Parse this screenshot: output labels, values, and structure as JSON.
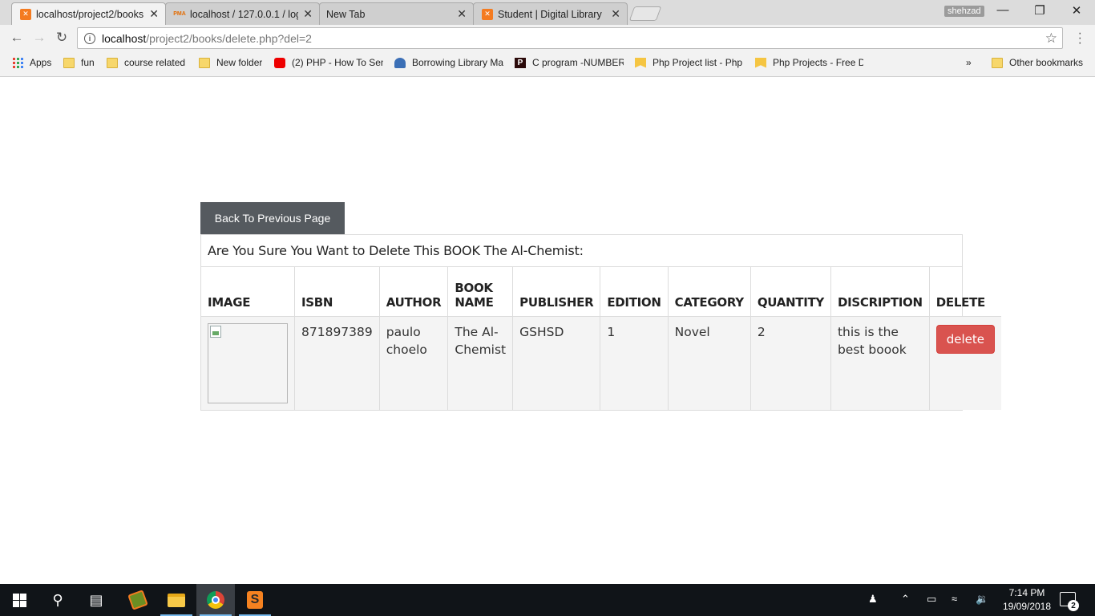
{
  "browser": {
    "tabs": [
      {
        "title": "localhost/project2/books",
        "favicon": "xampp-icon",
        "active": true
      },
      {
        "title": "localhost / 127.0.0.1 / log",
        "favicon": "phpmyadmin-icon",
        "active": false
      },
      {
        "title": "New Tab",
        "favicon": "",
        "active": false
      },
      {
        "title": "Student | Digital Library",
        "favicon": "xampp-icon",
        "active": false
      }
    ],
    "profile_name": "shehzad",
    "url_host": "localhost",
    "url_path": "/project2/books/delete.php?del=2"
  },
  "bookmarks": {
    "items": [
      {
        "label": "Apps",
        "icon": "apps-grid-icon"
      },
      {
        "label": "fun",
        "icon": "folder-icon"
      },
      {
        "label": "course related",
        "icon": "folder-icon"
      },
      {
        "label": "New folder",
        "icon": "folder-icon"
      },
      {
        "label": "(2) PHP - How To Sen",
        "icon": "youtube-icon"
      },
      {
        "label": "Borrowing Library Ma",
        "icon": "library-icon"
      },
      {
        "label": "C program -NUMBER",
        "icon": "p-icon"
      },
      {
        "label": "Php Project list - Php",
        "icon": "bookmark-pin-icon"
      },
      {
        "label": "Php Projects - Free D",
        "icon": "bookmark-pin-icon"
      }
    ],
    "overflow": "»",
    "other": "Other bookmarks"
  },
  "page": {
    "back_button": "Back To Previous Page",
    "heading": "Are You Sure You Want to Delete This BOOK The Al-Chemist:",
    "table": {
      "headers": [
        "IMAGE",
        "ISBN",
        "AUTHOR",
        "BOOK NAME",
        "PUBLISHER",
        "EDITION",
        "CATEGORY",
        "QUANTITY",
        "DISCRIPTION",
        "DELETE"
      ],
      "row": {
        "isbn": "871897389",
        "author": "paulo choelo",
        "book_name": "The Al-Chemist",
        "publisher": "GSHSD",
        "edition": "1",
        "category": "Novel",
        "quantity": "2",
        "description": "this is the best boook",
        "delete_label": "delete"
      }
    },
    "colors": {
      "back_button": "#555a5f",
      "delete_button": "#d9534f"
    }
  },
  "taskbar": {
    "time": "7:14 PM",
    "date": "19/09/2018",
    "notification_count": "2"
  }
}
